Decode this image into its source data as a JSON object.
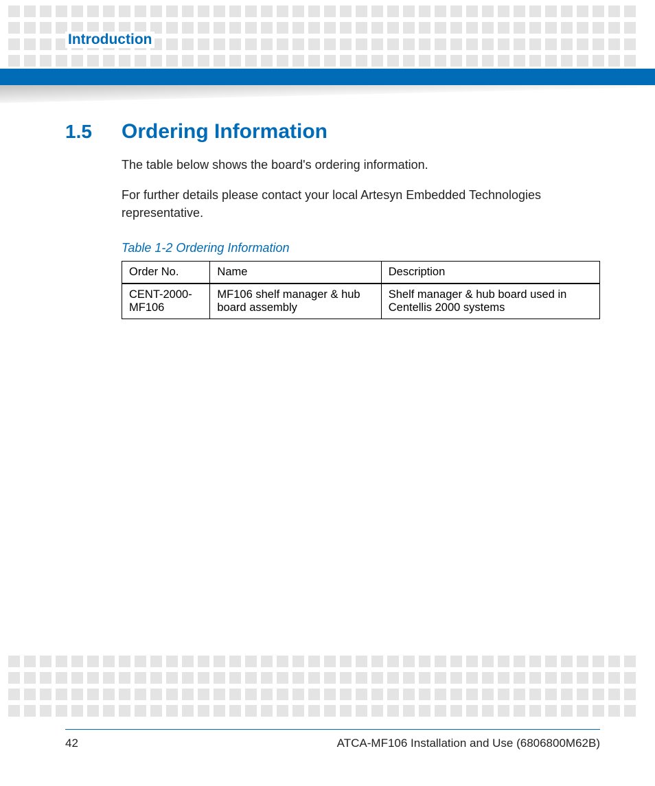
{
  "chapter": "Introduction",
  "section": {
    "number": "1.5",
    "title": "Ordering Information"
  },
  "paragraphs": {
    "p1": "The table below shows the board's ordering information.",
    "p2": "For further details please contact your local Artesyn Embedded Technologies representative."
  },
  "table": {
    "caption": "Table 1-2 Ordering Information",
    "headers": {
      "c1": "Order No.",
      "c2": "Name",
      "c3": "Description"
    },
    "rows": [
      {
        "c1": "CENT-2000-MF106",
        "c2": "MF106 shelf manager & hub board assembly",
        "c3": "Shelf manager & hub board used in Centellis 2000 systems"
      }
    ]
  },
  "footer": {
    "page": "42",
    "doc": "ATCA-MF106 Installation and Use (6806800M62B)"
  }
}
